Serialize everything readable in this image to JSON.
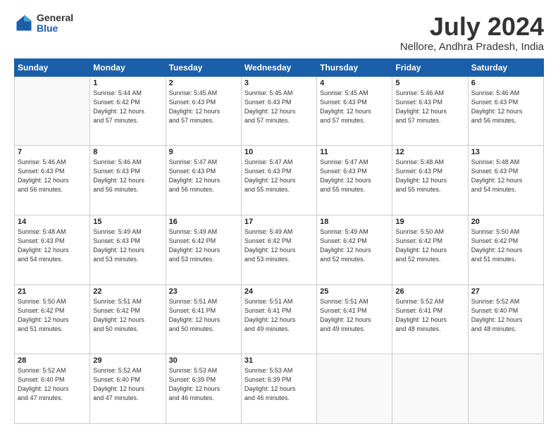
{
  "header": {
    "logo_general": "General",
    "logo_blue": "Blue",
    "title": "July 2024",
    "subtitle": "Nellore, Andhra Pradesh, India"
  },
  "calendar": {
    "headers": [
      "Sunday",
      "Monday",
      "Tuesday",
      "Wednesday",
      "Thursday",
      "Friday",
      "Saturday"
    ],
    "rows": [
      [
        {
          "day": "",
          "info": ""
        },
        {
          "day": "1",
          "info": "Sunrise: 5:44 AM\nSunset: 6:42 PM\nDaylight: 12 hours\nand 57 minutes."
        },
        {
          "day": "2",
          "info": "Sunrise: 5:45 AM\nSunset: 6:43 PM\nDaylight: 12 hours\nand 57 minutes."
        },
        {
          "day": "3",
          "info": "Sunrise: 5:45 AM\nSunset: 6:43 PM\nDaylight: 12 hours\nand 57 minutes."
        },
        {
          "day": "4",
          "info": "Sunrise: 5:45 AM\nSunset: 6:43 PM\nDaylight: 12 hours\nand 57 minutes."
        },
        {
          "day": "5",
          "info": "Sunrise: 5:46 AM\nSunset: 6:43 PM\nDaylight: 12 hours\nand 57 minutes."
        },
        {
          "day": "6",
          "info": "Sunrise: 5:46 AM\nSunset: 6:43 PM\nDaylight: 12 hours\nand 56 minutes."
        }
      ],
      [
        {
          "day": "7",
          "info": "Sunrise: 5:46 AM\nSunset: 6:43 PM\nDaylight: 12 hours\nand 56 minutes."
        },
        {
          "day": "8",
          "info": "Sunrise: 5:46 AM\nSunset: 6:43 PM\nDaylight: 12 hours\nand 56 minutes."
        },
        {
          "day": "9",
          "info": "Sunrise: 5:47 AM\nSunset: 6:43 PM\nDaylight: 12 hours\nand 56 minutes."
        },
        {
          "day": "10",
          "info": "Sunrise: 5:47 AM\nSunset: 6:43 PM\nDaylight: 12 hours\nand 55 minutes."
        },
        {
          "day": "11",
          "info": "Sunrise: 5:47 AM\nSunset: 6:43 PM\nDaylight: 12 hours\nand 55 minutes."
        },
        {
          "day": "12",
          "info": "Sunrise: 5:48 AM\nSunset: 6:43 PM\nDaylight: 12 hours\nand 55 minutes."
        },
        {
          "day": "13",
          "info": "Sunrise: 5:48 AM\nSunset: 6:43 PM\nDaylight: 12 hours\nand 54 minutes."
        }
      ],
      [
        {
          "day": "14",
          "info": "Sunrise: 5:48 AM\nSunset: 6:43 PM\nDaylight: 12 hours\nand 54 minutes."
        },
        {
          "day": "15",
          "info": "Sunrise: 5:49 AM\nSunset: 6:43 PM\nDaylight: 12 hours\nand 53 minutes."
        },
        {
          "day": "16",
          "info": "Sunrise: 5:49 AM\nSunset: 6:42 PM\nDaylight: 12 hours\nand 53 minutes."
        },
        {
          "day": "17",
          "info": "Sunrise: 5:49 AM\nSunset: 6:42 PM\nDaylight: 12 hours\nand 53 minutes."
        },
        {
          "day": "18",
          "info": "Sunrise: 5:49 AM\nSunset: 6:42 PM\nDaylight: 12 hours\nand 52 minutes."
        },
        {
          "day": "19",
          "info": "Sunrise: 5:50 AM\nSunset: 6:42 PM\nDaylight: 12 hours\nand 52 minutes."
        },
        {
          "day": "20",
          "info": "Sunrise: 5:50 AM\nSunset: 6:42 PM\nDaylight: 12 hours\nand 51 minutes."
        }
      ],
      [
        {
          "day": "21",
          "info": "Sunrise: 5:50 AM\nSunset: 6:42 PM\nDaylight: 12 hours\nand 51 minutes."
        },
        {
          "day": "22",
          "info": "Sunrise: 5:51 AM\nSunset: 6:42 PM\nDaylight: 12 hours\nand 50 minutes."
        },
        {
          "day": "23",
          "info": "Sunrise: 5:51 AM\nSunset: 6:41 PM\nDaylight: 12 hours\nand 50 minutes."
        },
        {
          "day": "24",
          "info": "Sunrise: 5:51 AM\nSunset: 6:41 PM\nDaylight: 12 hours\nand 49 minutes."
        },
        {
          "day": "25",
          "info": "Sunrise: 5:51 AM\nSunset: 6:41 PM\nDaylight: 12 hours\nand 49 minutes."
        },
        {
          "day": "26",
          "info": "Sunrise: 5:52 AM\nSunset: 6:41 PM\nDaylight: 12 hours\nand 48 minutes."
        },
        {
          "day": "27",
          "info": "Sunrise: 5:52 AM\nSunset: 6:40 PM\nDaylight: 12 hours\nand 48 minutes."
        }
      ],
      [
        {
          "day": "28",
          "info": "Sunrise: 5:52 AM\nSunset: 6:40 PM\nDaylight: 12 hours\nand 47 minutes."
        },
        {
          "day": "29",
          "info": "Sunrise: 5:52 AM\nSunset: 6:40 PM\nDaylight: 12 hours\nand 47 minutes."
        },
        {
          "day": "30",
          "info": "Sunrise: 5:53 AM\nSunset: 6:39 PM\nDaylight: 12 hours\nand 46 minutes."
        },
        {
          "day": "31",
          "info": "Sunrise: 5:53 AM\nSunset: 6:39 PM\nDaylight: 12 hours\nand 46 minutes."
        },
        {
          "day": "",
          "info": ""
        },
        {
          "day": "",
          "info": ""
        },
        {
          "day": "",
          "info": ""
        }
      ]
    ]
  }
}
